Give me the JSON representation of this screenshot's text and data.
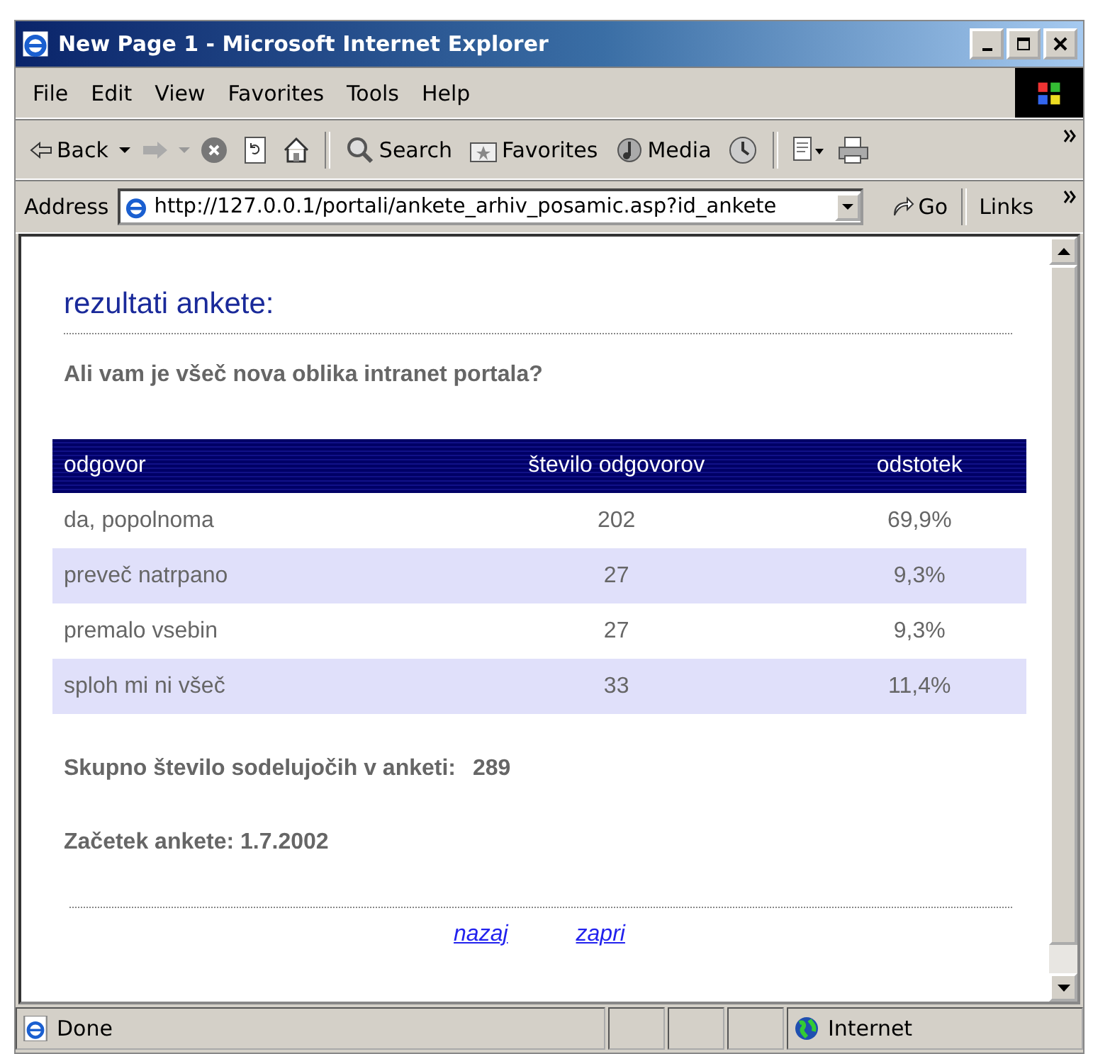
{
  "window": {
    "title": "New Page 1 - Microsoft Internet Explorer"
  },
  "menu": [
    {
      "label": "File"
    },
    {
      "label": "Edit"
    },
    {
      "label": "View"
    },
    {
      "label": "Favorites"
    },
    {
      "label": "Tools"
    },
    {
      "label": "Help"
    }
  ],
  "toolbar": {
    "back": "Back",
    "search": "Search",
    "favorites": "Favorites",
    "media": "Media"
  },
  "address": {
    "label": "Address",
    "value": "http://127.0.0.1/portali/ankete_arhiv_posamic.asp?id_ankete",
    "go": "Go",
    "links": "Links"
  },
  "page": {
    "heading": "rezultati ankete:",
    "question": "Ali vam je všeč nova oblika intranet portala?",
    "table": {
      "columns": [
        "odgovor",
        "število odgovorov",
        "odstotek"
      ],
      "rows": [
        [
          "da, popolnoma",
          "202",
          "69,9%"
        ],
        [
          "preveč natrpano",
          "27",
          "9,3%"
        ],
        [
          "premalo vsebin",
          "27",
          "9,3%"
        ],
        [
          "sploh mi ni všeč",
          "33",
          "11,4%"
        ]
      ]
    },
    "total_label": "Skupno število sodelujočih v anketi:",
    "total_value": "289",
    "start": "Začetek ankete: 1.7.2002",
    "links": [
      "nazaj",
      "zapri"
    ]
  },
  "status_bar": {
    "text": "Done",
    "zone": "Internet"
  }
}
